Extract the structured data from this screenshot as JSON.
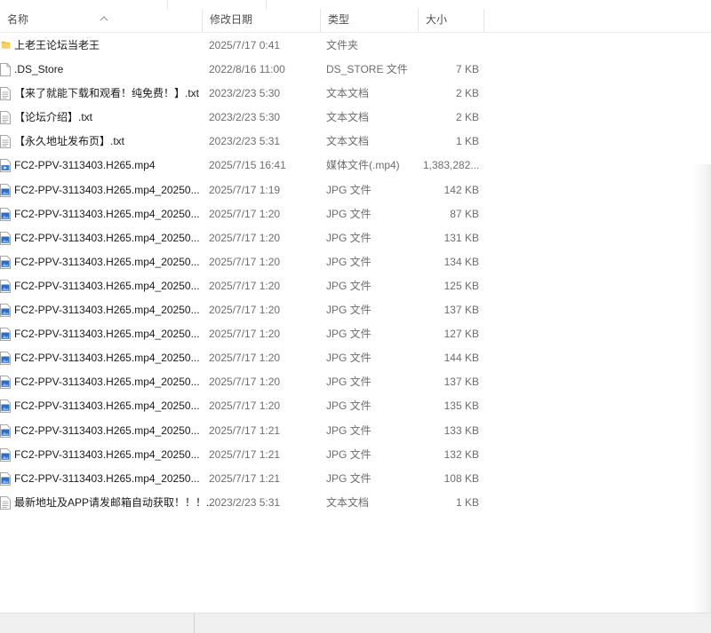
{
  "columns": {
    "name": "名称",
    "date": "修改日期",
    "type": "类型",
    "size": "大小"
  },
  "files": [
    {
      "icon": "folder-icon",
      "name": "上老王论坛当老王",
      "date": "2025/7/17 0:41",
      "type": "文件夹",
      "size": ""
    },
    {
      "icon": "file-icon",
      "name": ".DS_Store",
      "date": "2022/8/16 11:00",
      "type": "DS_STORE 文件",
      "size": "7 KB"
    },
    {
      "icon": "text-file-icon",
      "name": "【来了就能下载和观看！纯免费！】.txt",
      "date": "2023/2/23 5:30",
      "type": "文本文档",
      "size": "2 KB"
    },
    {
      "icon": "text-file-icon",
      "name": "【论坛介绍】.txt",
      "date": "2023/2/23 5:30",
      "type": "文本文档",
      "size": "2 KB"
    },
    {
      "icon": "text-file-icon",
      "name": "【永久地址发布页】.txt",
      "date": "2023/2/23 5:31",
      "type": "文本文档",
      "size": "1 KB"
    },
    {
      "icon": "video-file-icon",
      "name": "FC2-PPV-3113403.H265.mp4",
      "date": "2025/7/15 16:41",
      "type": "媒体文件(.mp4)",
      "size": "1,383,282..."
    },
    {
      "icon": "image-file-icon",
      "name": "FC2-PPV-3113403.H265.mp4_20250...",
      "date": "2025/7/17 1:19",
      "type": "JPG 文件",
      "size": "142 KB"
    },
    {
      "icon": "image-file-icon",
      "name": "FC2-PPV-3113403.H265.mp4_20250...",
      "date": "2025/7/17 1:20",
      "type": "JPG 文件",
      "size": "87 KB"
    },
    {
      "icon": "image-file-icon",
      "name": "FC2-PPV-3113403.H265.mp4_20250...",
      "date": "2025/7/17 1:20",
      "type": "JPG 文件",
      "size": "131 KB"
    },
    {
      "icon": "image-file-icon",
      "name": "FC2-PPV-3113403.H265.mp4_20250...",
      "date": "2025/7/17 1:20",
      "type": "JPG 文件",
      "size": "134 KB"
    },
    {
      "icon": "image-file-icon",
      "name": "FC2-PPV-3113403.H265.mp4_20250...",
      "date": "2025/7/17 1:20",
      "type": "JPG 文件",
      "size": "125 KB"
    },
    {
      "icon": "image-file-icon",
      "name": "FC2-PPV-3113403.H265.mp4_20250...",
      "date": "2025/7/17 1:20",
      "type": "JPG 文件",
      "size": "137 KB"
    },
    {
      "icon": "image-file-icon",
      "name": "FC2-PPV-3113403.H265.mp4_20250...",
      "date": "2025/7/17 1:20",
      "type": "JPG 文件",
      "size": "127 KB"
    },
    {
      "icon": "image-file-icon",
      "name": "FC2-PPV-3113403.H265.mp4_20250...",
      "date": "2025/7/17 1:20",
      "type": "JPG 文件",
      "size": "144 KB"
    },
    {
      "icon": "image-file-icon",
      "name": "FC2-PPV-3113403.H265.mp4_20250...",
      "date": "2025/7/17 1:20",
      "type": "JPG 文件",
      "size": "137 KB"
    },
    {
      "icon": "image-file-icon",
      "name": "FC2-PPV-3113403.H265.mp4_20250...",
      "date": "2025/7/17 1:20",
      "type": "JPG 文件",
      "size": "135 KB"
    },
    {
      "icon": "image-file-icon",
      "name": "FC2-PPV-3113403.H265.mp4_20250...",
      "date": "2025/7/17 1:21",
      "type": "JPG 文件",
      "size": "133 KB"
    },
    {
      "icon": "image-file-icon",
      "name": "FC2-PPV-3113403.H265.mp4_20250...",
      "date": "2025/7/17 1:21",
      "type": "JPG 文件",
      "size": "132 KB"
    },
    {
      "icon": "image-file-icon",
      "name": "FC2-PPV-3113403.H265.mp4_20250...",
      "date": "2025/7/17 1:21",
      "type": "JPG 文件",
      "size": "108 KB"
    },
    {
      "icon": "text-file-icon",
      "name": "最新地址及APP请发邮箱自动获取！！！...",
      "date": "2023/2/23 5:31",
      "type": "文本文档",
      "size": "1 KB"
    }
  ],
  "colors": {
    "folder": "#f5c242",
    "accent": "#2b6cc4"
  }
}
